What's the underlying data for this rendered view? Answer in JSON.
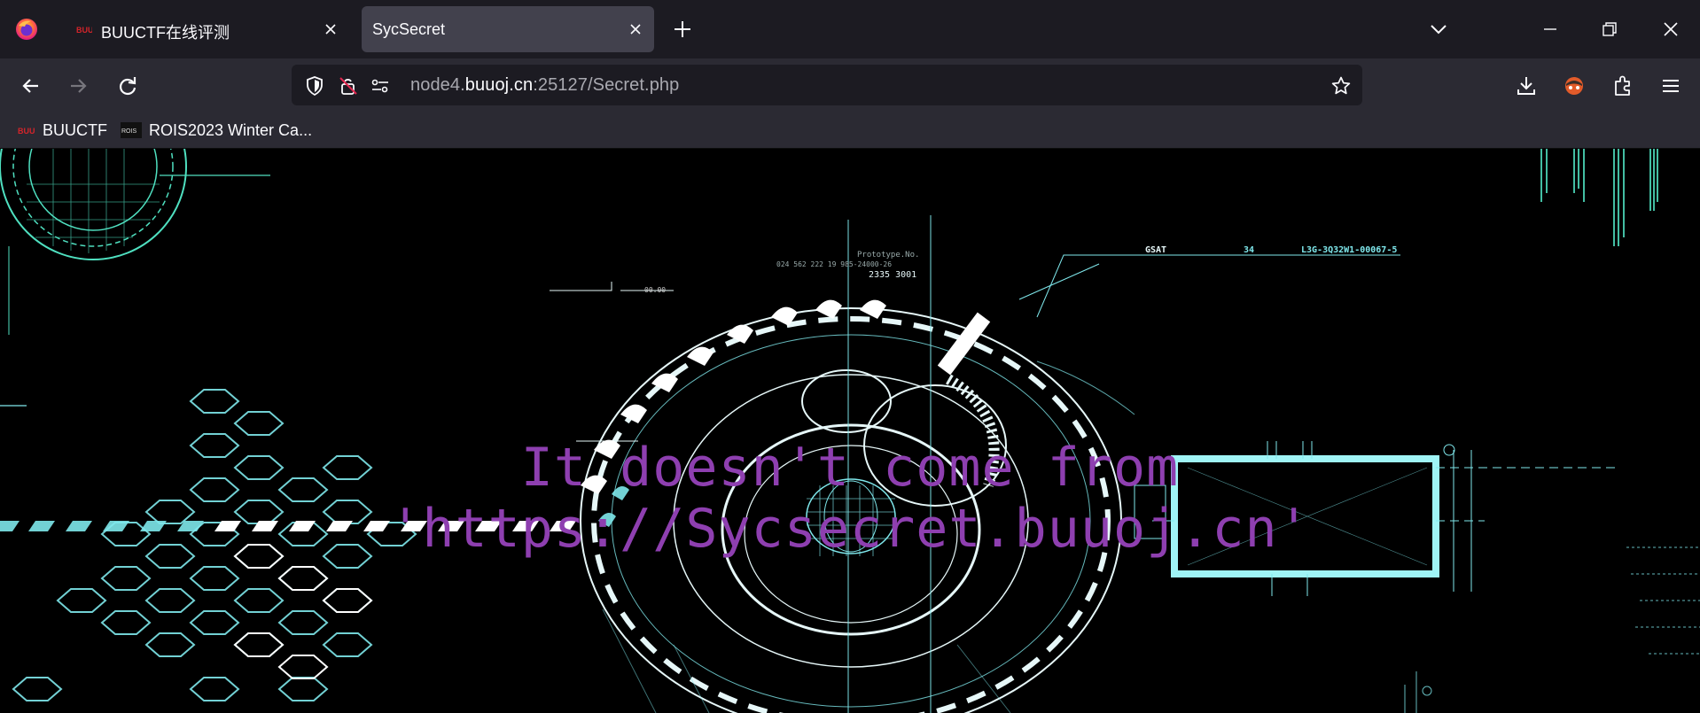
{
  "browser": {
    "tabs": [
      {
        "title": "BUUCTF在线评测",
        "active": false
      },
      {
        "title": "SycSecret",
        "active": true
      }
    ],
    "url": {
      "prefix": "node4.",
      "host": "buuoj.cn",
      "rest": ":25127/Secret.php"
    },
    "bookmarks": [
      {
        "label": "BUUCTF"
      },
      {
        "label": "ROIS2023 Winter Ca..."
      }
    ],
    "favicon_text": {
      "buuctf": "BUU",
      "rois": "ROIS"
    }
  },
  "page": {
    "message_line1": "It doesn't come from",
    "message_line2": "'https://Sycsecret.buuoj.cn'",
    "hud_text": {
      "gsat": "GSAT",
      "gsat_num": "34",
      "serial": "L3G-3Q32W1-00067-5",
      "prototype": "Prototype.No.",
      "proto_code": "024 562 222 19 985-24000-26",
      "proto_code2": "2335 3001",
      "small": "00.00"
    },
    "colors": {
      "message": "#8e3fb0",
      "hud": "#7fe8ec",
      "hud_white": "#e6f7f8"
    }
  },
  "icons": [
    "firefox-logo",
    "close-icon",
    "plus-icon",
    "chevron-down-icon",
    "minimize-icon",
    "restore-icon",
    "back-icon",
    "forward-icon",
    "reload-icon",
    "shield-icon",
    "insecure-lock-icon",
    "permissions-icon",
    "star-icon",
    "download-icon",
    "extension-icon",
    "menu-icon"
  ]
}
